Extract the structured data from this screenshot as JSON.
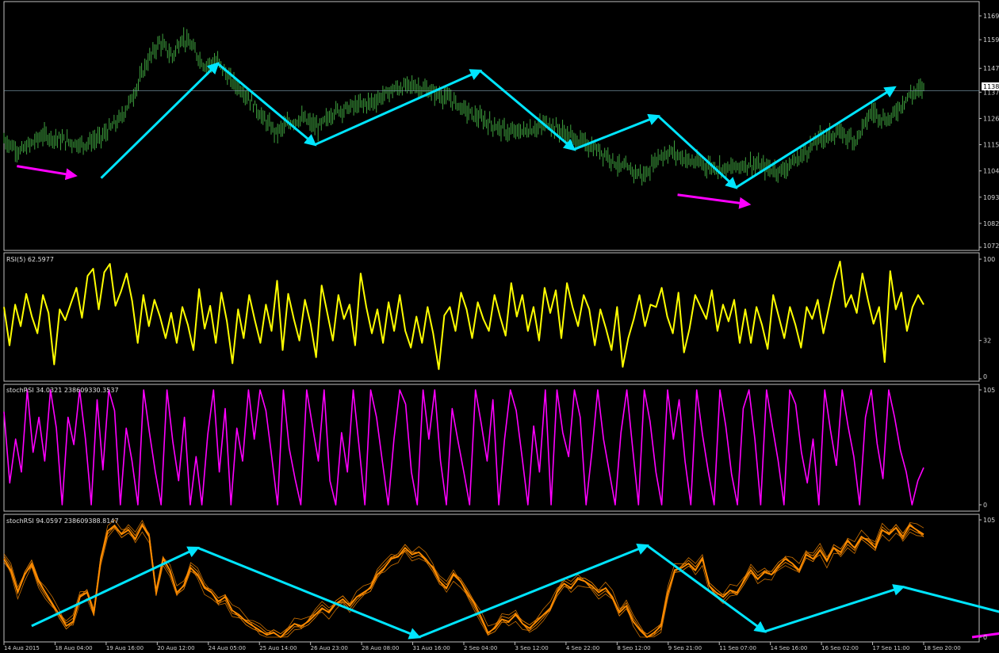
{
  "colors": {
    "background": "#000000",
    "frame": "#bfbfbf",
    "price_bars": "#3fa33f",
    "rsi_line": "#ffff00",
    "stoch_line": "#ff00ff",
    "smooth_lines": "#ff8c00",
    "trend_arrows": "#00e5ff",
    "divergence_arrows": "#ff00ff",
    "current_price_line": "#7f9fb0"
  },
  "chart_data": [
    {
      "type": "candlestick",
      "panel": "price",
      "title": "",
      "y_ticks": [
        "1169",
        "1159",
        "1147",
        "1137",
        "1126",
        "1115",
        "1104",
        "1093",
        "1082",
        "1072"
      ],
      "ylim": [
        1072,
        1169
      ],
      "current_price_label": "1138",
      "current_price": 1137.6,
      "close_path": [
        [
          0,
          1117
        ],
        [
          5,
          1112
        ],
        [
          12,
          1119
        ],
        [
          18,
          1117
        ],
        [
          24,
          1115
        ],
        [
          30,
          1118
        ],
        [
          36,
          1126
        ],
        [
          40,
          1136
        ],
        [
          44,
          1149
        ],
        [
          48,
          1158
        ],
        [
          52,
          1152
        ],
        [
          55,
          1160
        ],
        [
          58,
          1156
        ],
        [
          62,
          1148
        ],
        [
          66,
          1150
        ],
        [
          70,
          1142
        ],
        [
          75,
          1136
        ],
        [
          80,
          1126
        ],
        [
          84,
          1120
        ],
        [
          88,
          1124
        ],
        [
          92,
          1126
        ],
        [
          97,
          1122
        ],
        [
          102,
          1129
        ],
        [
          108,
          1131
        ],
        [
          114,
          1133
        ],
        [
          120,
          1138
        ],
        [
          126,
          1140
        ],
        [
          132,
          1137
        ],
        [
          138,
          1134
        ],
        [
          144,
          1128
        ],
        [
          150,
          1124
        ],
        [
          156,
          1120
        ],
        [
          162,
          1121
        ],
        [
          168,
          1124
        ],
        [
          174,
          1119
        ],
        [
          180,
          1115
        ],
        [
          186,
          1111
        ],
        [
          190,
          1106
        ],
        [
          194,
          1104
        ],
        [
          198,
          1102
        ],
        [
          202,
          1110
        ],
        [
          206,
          1112
        ],
        [
          212,
          1108
        ],
        [
          218,
          1106
        ],
        [
          224,
          1105
        ],
        [
          230,
          1107
        ],
        [
          236,
          1105
        ],
        [
          240,
          1104
        ],
        [
          246,
          1110
        ],
        [
          252,
          1118
        ],
        [
          258,
          1120
        ],
        [
          263,
          1117
        ],
        [
          268,
          1129
        ],
        [
          273,
          1125
        ],
        [
          279,
          1135
        ],
        [
          284,
          1139
        ]
      ],
      "trend_arrows": [
        [
          [
            30,
            1101
          ],
          [
            66,
            1149
          ]
        ],
        [
          [
            66,
            1149
          ],
          [
            96,
            1115
          ]
        ],
        [
          [
            96,
            1115
          ],
          [
            147,
            1146
          ]
        ],
        [
          [
            147,
            1146
          ],
          [
            176,
            1113
          ]
        ],
        [
          [
            176,
            1113
          ],
          [
            202,
            1127
          ]
        ],
        [
          [
            202,
            1127
          ],
          [
            226,
            1097
          ]
        ],
        [
          [
            226,
            1097
          ],
          [
            275,
            1139
          ]
        ]
      ],
      "divergence_arrows": [
        [
          [
            4,
            1106
          ],
          [
            22,
            1102
          ]
        ],
        [
          [
            208,
            1094
          ],
          [
            230,
            1090
          ]
        ]
      ]
    },
    {
      "type": "line",
      "panel": "rsi",
      "title": "RSI(5) 62.5977",
      "y_ticks": [
        "100",
        "32",
        "0"
      ],
      "ylim": [
        0,
        100
      ],
      "series": [
        {
          "name": "RSI(5)",
          "color": "#ffff00",
          "values": [
            60,
            28,
            62,
            44,
            71,
            52,
            38,
            70,
            55,
            12,
            58,
            49,
            63,
            76,
            51,
            86,
            92,
            58,
            89,
            96,
            61,
            73,
            88,
            65,
            30,
            70,
            44,
            66,
            52,
            34,
            55,
            30,
            60,
            45,
            24,
            75,
            42,
            61,
            30,
            72,
            48,
            13,
            58,
            34,
            70,
            49,
            30,
            62,
            40,
            82,
            24,
            71,
            50,
            32,
            66,
            46,
            18,
            78,
            55,
            32,
            70,
            50,
            62,
            28,
            88,
            60,
            38,
            58,
            30,
            64,
            40,
            70,
            40,
            26,
            52,
            30,
            60,
            38,
            8,
            53,
            60,
            40,
            72,
            58,
            34,
            64,
            50,
            40,
            70,
            52,
            36,
            80,
            52,
            70,
            40,
            60,
            32,
            76,
            55,
            74,
            34,
            80,
            60,
            44,
            70,
            58,
            28,
            58,
            42,
            24,
            60,
            10,
            34,
            50,
            70,
            44,
            62,
            60,
            76,
            52,
            38,
            72,
            22,
            42,
            70,
            60,
            50,
            74,
            40,
            62,
            48,
            66,
            30,
            58,
            30,
            60,
            45,
            25,
            70,
            52,
            34,
            60,
            45,
            26,
            60,
            50,
            66,
            38,
            60,
            82,
            98,
            60,
            70,
            55,
            88,
            66,
            46,
            60,
            14,
            90,
            58,
            72,
            40,
            60,
            70,
            62
          ]
        }
      ]
    },
    {
      "type": "line",
      "panel": "stoch_rsi",
      "title": "stochRSI 34.0321 238609330.3537",
      "y_ticks": [
        "105",
        "0"
      ],
      "ylim": [
        0,
        105
      ],
      "series": [
        {
          "name": "stochRSI",
          "color": "#ff00ff",
          "values": [
            85,
            20,
            60,
            30,
            105,
            48,
            80,
            40,
            105,
            70,
            0,
            80,
            55,
            105,
            60,
            0,
            96,
            32,
            105,
            86,
            0,
            70,
            40,
            0,
            105,
            66,
            30,
            0,
            105,
            58,
            22,
            80,
            0,
            44,
            0,
            64,
            105,
            30,
            88,
            0,
            70,
            40,
            105,
            60,
            105,
            86,
            44,
            0,
            105,
            52,
            24,
            0,
            105,
            72,
            40,
            105,
            22,
            0,
            66,
            30,
            105,
            54,
            0,
            105,
            80,
            40,
            0,
            60,
            105,
            92,
            30,
            0,
            105,
            60,
            105,
            40,
            0,
            88,
            58,
            30,
            0,
            105,
            74,
            40,
            96,
            0,
            60,
            105,
            86,
            44,
            0,
            72,
            30,
            105,
            0,
            105,
            66,
            44,
            105,
            80,
            0,
            48,
            105,
            60,
            30,
            0,
            66,
            105,
            52,
            0,
            105,
            76,
            30,
            0,
            105,
            60,
            96,
            40,
            0,
            105,
            64,
            30,
            0,
            105,
            72,
            28,
            0,
            88,
            105,
            60,
            0,
            105,
            72,
            40,
            0,
            105,
            92,
            48,
            20,
            60,
            0,
            105,
            68,
            36,
            105,
            72,
            44,
            0,
            80,
            105,
            56,
            24,
            105,
            80,
            50,
            30,
            0,
            22,
            34
          ]
        }
      ]
    },
    {
      "type": "line",
      "panel": "stoch_rsi_smoothed",
      "title": "stochRSI 94.0597 238609388.8147",
      "ylim": [
        0,
        105
      ],
      "y_ticks": [
        "105",
        "0"
      ],
      "series": [
        {
          "name": "stochRSI",
          "color": "#ff9500",
          "values": [
            70,
            60,
            40,
            56,
            66,
            50,
            40,
            30,
            20,
            10,
            14,
            36,
            40,
            22,
            70,
            95,
            100,
            92,
            96,
            88,
            100,
            90,
            40,
            70,
            60,
            40,
            46,
            62,
            56,
            44,
            40,
            32,
            36,
            24,
            20,
            14,
            10,
            6,
            2,
            4,
            0,
            6,
            12,
            10,
            14,
            20,
            26,
            22,
            30,
            34,
            28,
            36,
            40,
            44,
            56,
            62,
            70,
            72,
            80,
            74,
            76,
            70,
            62,
            50,
            44,
            56,
            50,
            40,
            30,
            18,
            4,
            8,
            16,
            14,
            20,
            12,
            8,
            14,
            20,
            26,
            40,
            48,
            44,
            52,
            50,
            46,
            40,
            44,
            36,
            22,
            28,
            14,
            6,
            0,
            4,
            10,
            40,
            60,
            62,
            66,
            60,
            70,
            46,
            40,
            36,
            42,
            40,
            50,
            60,
            52,
            58,
            56,
            64,
            70,
            66,
            60,
            74,
            70,
            78,
            68,
            80,
            76,
            86,
            80,
            90,
            86,
            80,
            96,
            92,
            98,
            90,
            100,
            96,
            92
          ]
        }
      ],
      "trend_arrows": [
        [
          [
            4,
            10
          ],
          [
            28,
            80
          ]
        ],
        [
          [
            28,
            80
          ],
          [
            60,
            0
          ]
        ],
        [
          [
            60,
            0
          ],
          [
            93,
            82
          ]
        ],
        [
          [
            93,
            82
          ],
          [
            110,
            5
          ]
        ],
        [
          [
            110,
            5
          ],
          [
            130,
            45
          ]
        ],
        [
          [
            130,
            45
          ],
          [
            155,
            5
          ]
        ],
        [
          [
            155,
            5
          ],
          [
            193,
            100
          ]
        ]
      ],
      "divergence_arrows": [
        [
          [
            140,
            0
          ],
          [
            152,
            10
          ]
        ]
      ]
    }
  ],
  "date_labels": [
    "14 Aug 2015",
    "18 Aug 04:00",
    "19 Aug 16:00",
    "20 Aug 12:00",
    "24 Aug 05:00",
    "25 Aug 14:00",
    "26 Aug 23:00",
    "28 Aug 08:00",
    "31 Aug 16:00",
    "2 Sep 04:00",
    "3 Sep 12:00",
    "4 Sep 22:00",
    "8 Sep 12:00",
    "9 Sep 21:00",
    "11 Sep 07:00",
    "14 Sep 16:00",
    "16 Sep 02:00",
    "17 Sep 11:00",
    "18 Sep 20:00"
  ]
}
